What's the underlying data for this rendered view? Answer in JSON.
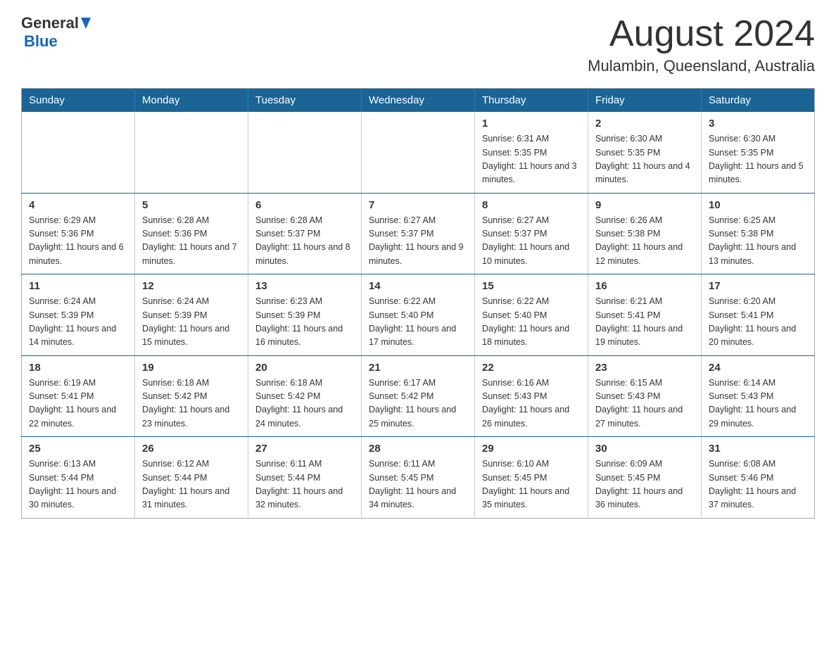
{
  "header": {
    "logo_general": "General",
    "logo_blue": "Blue",
    "month_year": "August 2024",
    "location": "Mulambin, Queensland, Australia"
  },
  "weekdays": [
    "Sunday",
    "Monday",
    "Tuesday",
    "Wednesday",
    "Thursday",
    "Friday",
    "Saturday"
  ],
  "weeks": [
    [
      {
        "day": "",
        "info": ""
      },
      {
        "day": "",
        "info": ""
      },
      {
        "day": "",
        "info": ""
      },
      {
        "day": "",
        "info": ""
      },
      {
        "day": "1",
        "info": "Sunrise: 6:31 AM\nSunset: 5:35 PM\nDaylight: 11 hours\nand 3 minutes."
      },
      {
        "day": "2",
        "info": "Sunrise: 6:30 AM\nSunset: 5:35 PM\nDaylight: 11 hours\nand 4 minutes."
      },
      {
        "day": "3",
        "info": "Sunrise: 6:30 AM\nSunset: 5:35 PM\nDaylight: 11 hours\nand 5 minutes."
      }
    ],
    [
      {
        "day": "4",
        "info": "Sunrise: 6:29 AM\nSunset: 5:36 PM\nDaylight: 11 hours\nand 6 minutes."
      },
      {
        "day": "5",
        "info": "Sunrise: 6:28 AM\nSunset: 5:36 PM\nDaylight: 11 hours\nand 7 minutes."
      },
      {
        "day": "6",
        "info": "Sunrise: 6:28 AM\nSunset: 5:37 PM\nDaylight: 11 hours\nand 8 minutes."
      },
      {
        "day": "7",
        "info": "Sunrise: 6:27 AM\nSunset: 5:37 PM\nDaylight: 11 hours\nand 9 minutes."
      },
      {
        "day": "8",
        "info": "Sunrise: 6:27 AM\nSunset: 5:37 PM\nDaylight: 11 hours\nand 10 minutes."
      },
      {
        "day": "9",
        "info": "Sunrise: 6:26 AM\nSunset: 5:38 PM\nDaylight: 11 hours\nand 12 minutes."
      },
      {
        "day": "10",
        "info": "Sunrise: 6:25 AM\nSunset: 5:38 PM\nDaylight: 11 hours\nand 13 minutes."
      }
    ],
    [
      {
        "day": "11",
        "info": "Sunrise: 6:24 AM\nSunset: 5:39 PM\nDaylight: 11 hours\nand 14 minutes."
      },
      {
        "day": "12",
        "info": "Sunrise: 6:24 AM\nSunset: 5:39 PM\nDaylight: 11 hours\nand 15 minutes."
      },
      {
        "day": "13",
        "info": "Sunrise: 6:23 AM\nSunset: 5:39 PM\nDaylight: 11 hours\nand 16 minutes."
      },
      {
        "day": "14",
        "info": "Sunrise: 6:22 AM\nSunset: 5:40 PM\nDaylight: 11 hours\nand 17 minutes."
      },
      {
        "day": "15",
        "info": "Sunrise: 6:22 AM\nSunset: 5:40 PM\nDaylight: 11 hours\nand 18 minutes."
      },
      {
        "day": "16",
        "info": "Sunrise: 6:21 AM\nSunset: 5:41 PM\nDaylight: 11 hours\nand 19 minutes."
      },
      {
        "day": "17",
        "info": "Sunrise: 6:20 AM\nSunset: 5:41 PM\nDaylight: 11 hours\nand 20 minutes."
      }
    ],
    [
      {
        "day": "18",
        "info": "Sunrise: 6:19 AM\nSunset: 5:41 PM\nDaylight: 11 hours\nand 22 minutes."
      },
      {
        "day": "19",
        "info": "Sunrise: 6:18 AM\nSunset: 5:42 PM\nDaylight: 11 hours\nand 23 minutes."
      },
      {
        "day": "20",
        "info": "Sunrise: 6:18 AM\nSunset: 5:42 PM\nDaylight: 11 hours\nand 24 minutes."
      },
      {
        "day": "21",
        "info": "Sunrise: 6:17 AM\nSunset: 5:42 PM\nDaylight: 11 hours\nand 25 minutes."
      },
      {
        "day": "22",
        "info": "Sunrise: 6:16 AM\nSunset: 5:43 PM\nDaylight: 11 hours\nand 26 minutes."
      },
      {
        "day": "23",
        "info": "Sunrise: 6:15 AM\nSunset: 5:43 PM\nDaylight: 11 hours\nand 27 minutes."
      },
      {
        "day": "24",
        "info": "Sunrise: 6:14 AM\nSunset: 5:43 PM\nDaylight: 11 hours\nand 29 minutes."
      }
    ],
    [
      {
        "day": "25",
        "info": "Sunrise: 6:13 AM\nSunset: 5:44 PM\nDaylight: 11 hours\nand 30 minutes."
      },
      {
        "day": "26",
        "info": "Sunrise: 6:12 AM\nSunset: 5:44 PM\nDaylight: 11 hours\nand 31 minutes."
      },
      {
        "day": "27",
        "info": "Sunrise: 6:11 AM\nSunset: 5:44 PM\nDaylight: 11 hours\nand 32 minutes."
      },
      {
        "day": "28",
        "info": "Sunrise: 6:11 AM\nSunset: 5:45 PM\nDaylight: 11 hours\nand 34 minutes."
      },
      {
        "day": "29",
        "info": "Sunrise: 6:10 AM\nSunset: 5:45 PM\nDaylight: 11 hours\nand 35 minutes."
      },
      {
        "day": "30",
        "info": "Sunrise: 6:09 AM\nSunset: 5:45 PM\nDaylight: 11 hours\nand 36 minutes."
      },
      {
        "day": "31",
        "info": "Sunrise: 6:08 AM\nSunset: 5:46 PM\nDaylight: 11 hours\nand 37 minutes."
      }
    ]
  ]
}
